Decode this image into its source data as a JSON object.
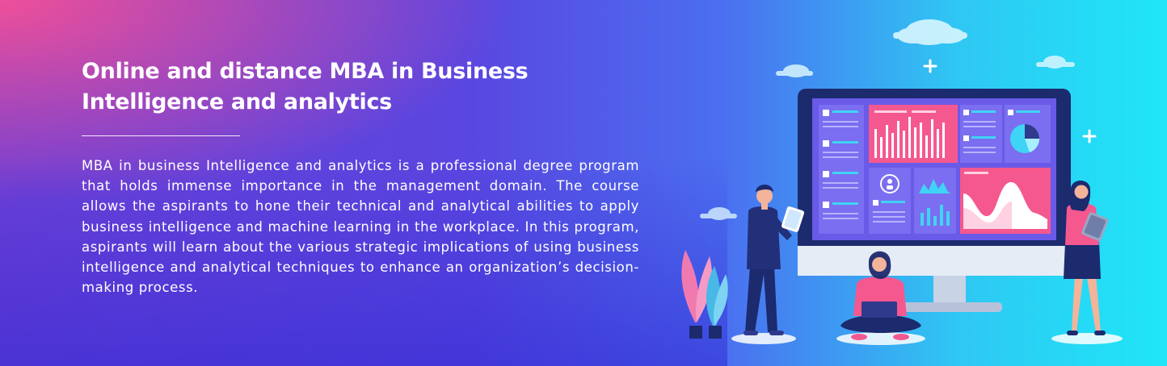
{
  "banner": {
    "title": "Online and distance MBA in Business Intelligence and analytics",
    "description": "MBA in business Intelligence and analytics is a professional degree program that holds immense importance in the management domain. The course allows the aspirants to hone their technical and analytical abilities to apply business intelligence and machine learning in the workplace. In this program, aspirants will learn about the various strategic implications of using business intelligence and analytical techniques to enhance an organization’s decision-making process."
  },
  "colors": {
    "accent_pink": "#f5588f",
    "screen_purple": "#6a5ae8",
    "navy": "#1c2a6e",
    "cyan": "#1fe6f7"
  },
  "icons": [
    "cloud-icon",
    "plus-icon",
    "pie-chart-icon",
    "user-icon"
  ]
}
